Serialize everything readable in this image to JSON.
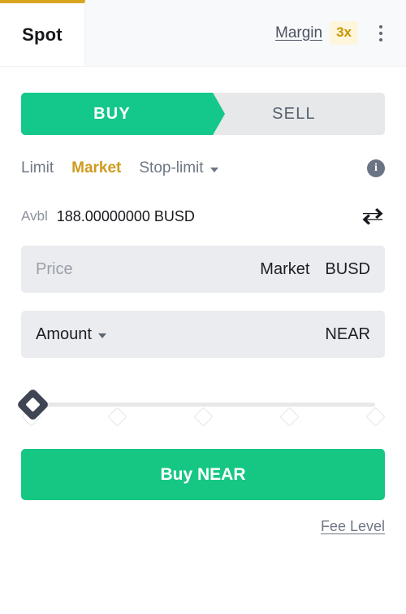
{
  "tabs": {
    "spot_label": "Spot",
    "margin_label": "Margin",
    "margin_leverage": "3x",
    "more_icon": "kebab-menu-icon",
    "active": "Spot",
    "accent_color": "#d9a521",
    "badge_bg": "#fdf6dd",
    "badge_fg": "#c99400"
  },
  "side_toggle": {
    "buy_label": "BUY",
    "sell_label": "SELL",
    "active": "BUY",
    "buy_color": "#14c88b",
    "inactive_bg": "#e6e8ea"
  },
  "order_types": {
    "items": [
      {
        "label": "Limit",
        "active": false
      },
      {
        "label": "Market",
        "active": true
      },
      {
        "label": "Stop-limit",
        "active": false,
        "has_caret": true
      }
    ],
    "active_color": "#cf9b20",
    "info_icon": "info-circle-icon"
  },
  "available": {
    "label": "Avbl",
    "value": "188.00000000 BUSD",
    "amount": "188.00000000",
    "asset": "BUSD",
    "swap_icon": "transfer-swap-icon"
  },
  "price_field": {
    "placeholder": "Price",
    "value": "",
    "mode_label": "Market",
    "unit": "BUSD"
  },
  "amount_field": {
    "label": "Amount",
    "value": "",
    "unit": "NEAR",
    "has_caret": true
  },
  "slider": {
    "value": 0,
    "min": 0,
    "max": 100,
    "ticks": [
      0,
      25,
      50,
      75,
      100
    ],
    "handle_color": "#3f4554",
    "track_color": "#e6e8ea"
  },
  "submit": {
    "label": "Buy NEAR",
    "color": "#16c784"
  },
  "footer": {
    "fee_level_label": "Fee Level"
  }
}
